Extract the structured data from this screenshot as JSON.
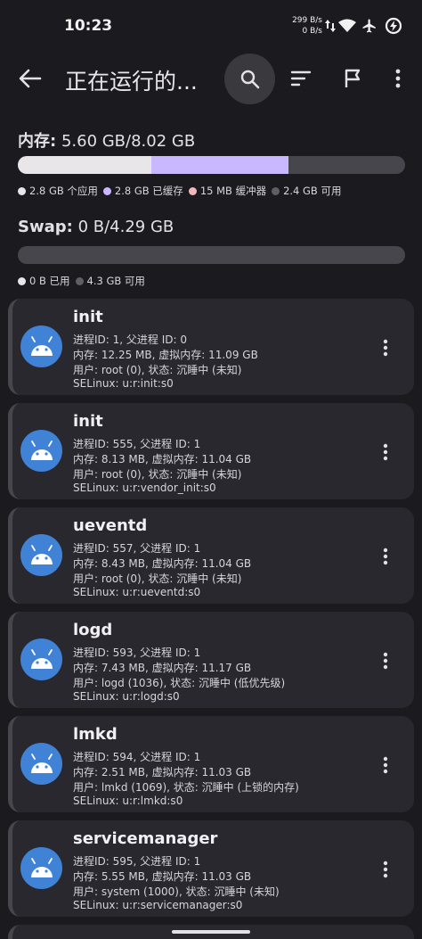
{
  "status_bar": {
    "time": "10:23",
    "speed_up": "299 B/s",
    "speed_down": "0 B/s"
  },
  "app_bar": {
    "title": "正在运行的..."
  },
  "memory": {
    "label": "内存:",
    "value": "5.60 GB/8.02 GB",
    "segments": [
      {
        "name": "apps",
        "fraction": 0.345,
        "color": "#e9e6e9"
      },
      {
        "name": "cached",
        "fraction": 0.352,
        "color": "#c9b8ff"
      },
      {
        "name": "buffers",
        "fraction": 0.002,
        "color": "#f0b8bd"
      }
    ],
    "legend": [
      {
        "text": "2.8 GB 个应用",
        "color": "#e9e6e9"
      },
      {
        "text": "2.8 GB 已缓存",
        "color": "#c9b8ff"
      },
      {
        "text": "15 MB 缓冲器",
        "color": "#f0b8bd"
      },
      {
        "text": "2.4 GB 可用",
        "color": "#5f5e64"
      }
    ]
  },
  "swap": {
    "label": "Swap:",
    "value": "0 B/4.29 GB",
    "legend": [
      {
        "text": "0 B 已用",
        "color": "#e9e6e9"
      },
      {
        "text": "4.3 GB 可用",
        "color": "#5f5e64"
      }
    ]
  },
  "processes": [
    {
      "name": "init",
      "ids": "进程ID: 1, 父进程 ID: 0",
      "memory": "内存: 12.25 MB, 虚拟内存: 11.09 GB",
      "user": "用户: root (0), 状态: 沉睡中 (未知)",
      "selinux": "SELinux:  u:r:init:s0"
    },
    {
      "name": "init",
      "ids": "进程ID: 555, 父进程 ID: 1",
      "memory": "内存: 8.13 MB, 虚拟内存: 11.04 GB",
      "user": "用户: root (0), 状态: 沉睡中 (未知)",
      "selinux": "SELinux:  u:r:vendor_init:s0"
    },
    {
      "name": "ueventd",
      "ids": "进程ID: 557, 父进程 ID: 1",
      "memory": "内存: 8.43 MB, 虚拟内存: 11.04 GB",
      "user": "用户: root (0), 状态: 沉睡中 (未知)",
      "selinux": "SELinux:  u:r:ueventd:s0"
    },
    {
      "name": "logd",
      "ids": "进程ID: 593, 父进程 ID: 1",
      "memory": "内存: 7.43 MB, 虚拟内存: 11.17 GB",
      "user": "用户: logd (1036), 状态: 沉睡中 (低优先级)",
      "selinux": "SELinux:  u:r:logd:s0"
    },
    {
      "name": "lmkd",
      "ids": "进程ID: 594, 父进程 ID: 1",
      "memory": "内存: 2.51 MB, 虚拟内存: 11.03 GB",
      "user": "用户: lmkd (1069), 状态: 沉睡中 (上锁的内存)",
      "selinux": "SELinux:  u:r:lmkd:s0"
    },
    {
      "name": "servicemanager",
      "ids": "进程ID: 595, 父进程 ID: 1",
      "memory": "内存: 5.55 MB, 虚拟内存: 11.03 GB",
      "user": "用户: system (1000), 状态: 沉睡中 (未知)",
      "selinux": "SELinux:  u:r:servicemanager:s0"
    }
  ]
}
